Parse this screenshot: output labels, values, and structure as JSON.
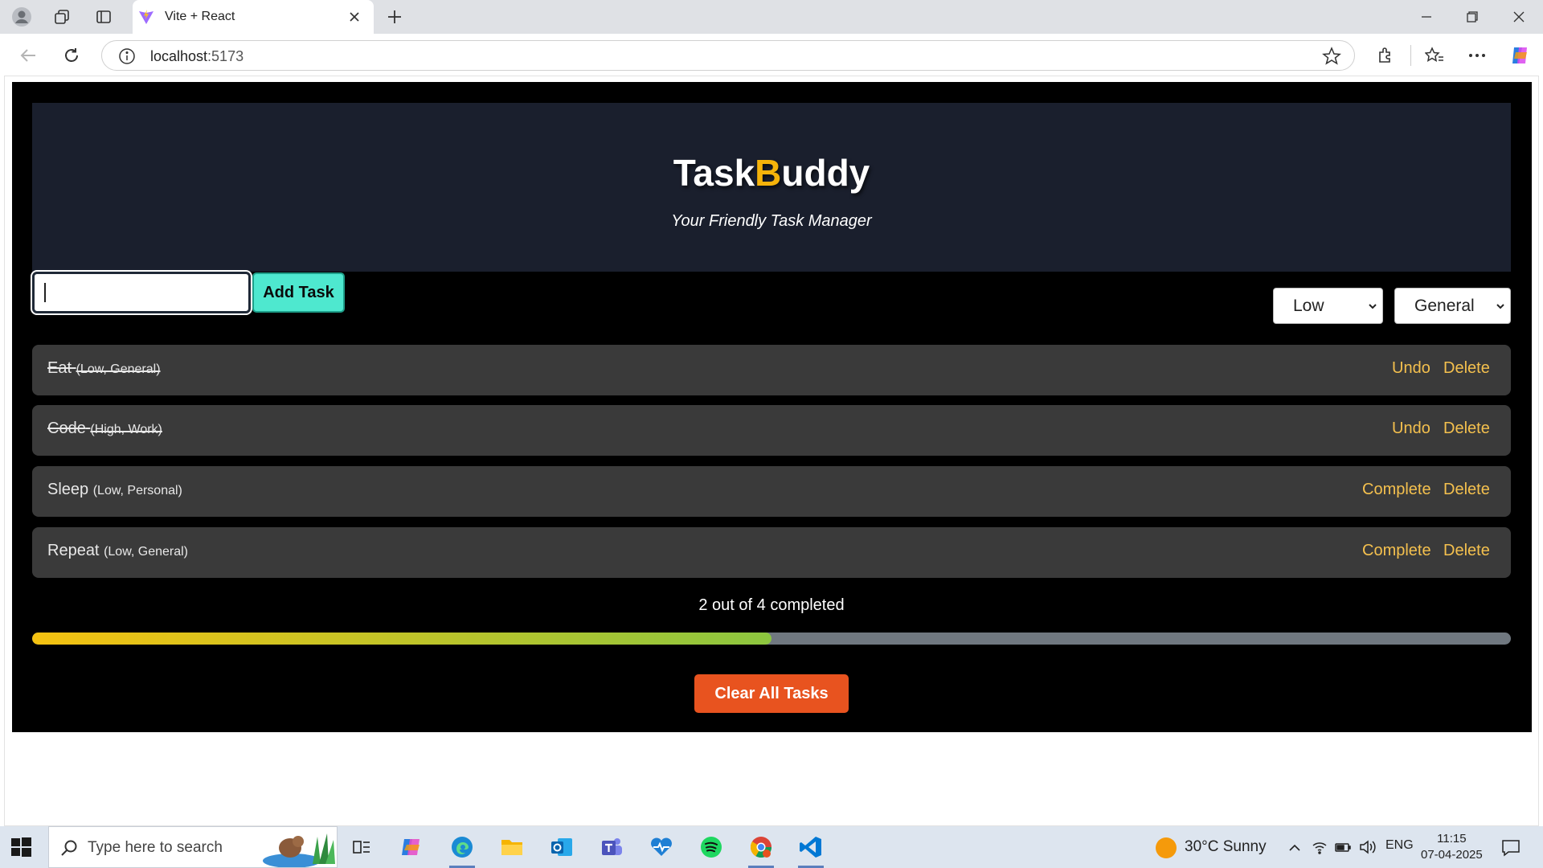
{
  "browser": {
    "tab_title": "Vite + React",
    "url_host": "localhost",
    "url_port": ":5173"
  },
  "app": {
    "title_part1": "Task",
    "title_accent": "B",
    "title_part2": "uddy",
    "subtitle": "Your Friendly Task Manager",
    "input_value": "",
    "add_label": "Add Task",
    "priority_selected": "Low",
    "category_selected": "General",
    "tasks": [
      {
        "name": "Eat",
        "meta": "(Low, General)",
        "completed": true,
        "action": "Undo",
        "delete": "Delete"
      },
      {
        "name": "Code",
        "meta": "(High, Work)",
        "completed": true,
        "action": "Undo",
        "delete": "Delete"
      },
      {
        "name": "Sleep",
        "meta": "(Low, Personal)",
        "completed": false,
        "action": "Complete",
        "delete": "Delete"
      },
      {
        "name": "Repeat",
        "meta": "(Low, General)",
        "completed": false,
        "action": "Complete",
        "delete": "Delete"
      }
    ],
    "progress_text": "2 out of 4 completed",
    "progress_fraction": 0.5,
    "clear_label": "Clear All Tasks",
    "colors": {
      "accent": "#f5b30a",
      "action": "#f4c04e",
      "add_button": "#4ee8cf",
      "clear_button": "#e8531f"
    }
  },
  "taskbar": {
    "search_placeholder": "Type here to search",
    "weather": "30°C  Sunny",
    "language": "ENG",
    "time": "11:15",
    "date": "07-04-2025"
  }
}
